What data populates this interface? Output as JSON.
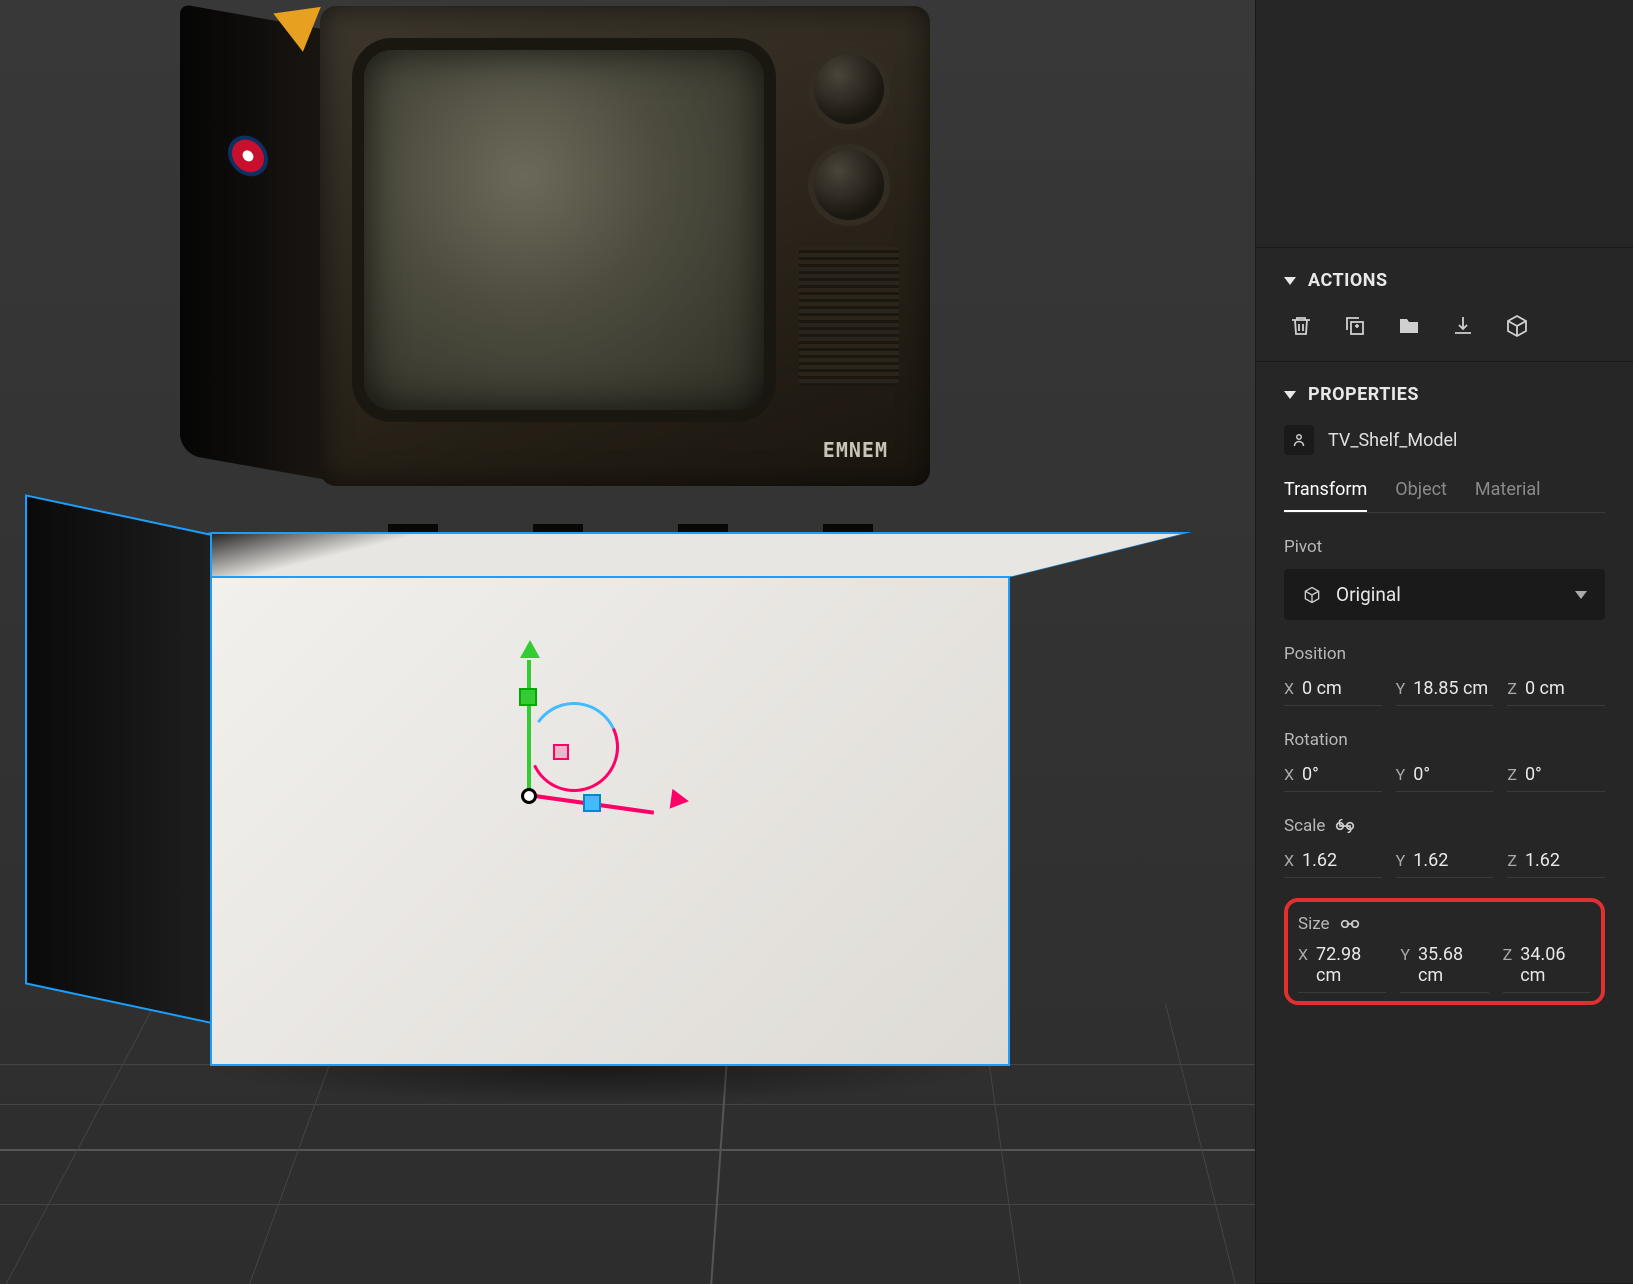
{
  "viewport": {
    "tv_brand": "EMNEM"
  },
  "sidebar": {
    "actions_header": "ACTIONS",
    "properties_header": "PROPERTIES",
    "object_name": "TV_Shelf_Model",
    "tabs": {
      "transform": "Transform",
      "object": "Object",
      "material": "Material"
    },
    "pivot": {
      "label": "Pivot",
      "value": "Original"
    },
    "position": {
      "label": "Position",
      "x": "0 cm",
      "y": "18.85 cm",
      "z": "0 cm"
    },
    "rotation": {
      "label": "Rotation",
      "x": "0°",
      "y": "0°",
      "z": "0°"
    },
    "scale": {
      "label": "Scale",
      "x": "1.62",
      "y": "1.62",
      "z": "1.62"
    },
    "size": {
      "label": "Size",
      "x": "72.98 cm",
      "y": "35.68 cm",
      "z": "34.06 cm"
    },
    "axis": {
      "x": "X",
      "y": "Y",
      "z": "Z"
    }
  }
}
